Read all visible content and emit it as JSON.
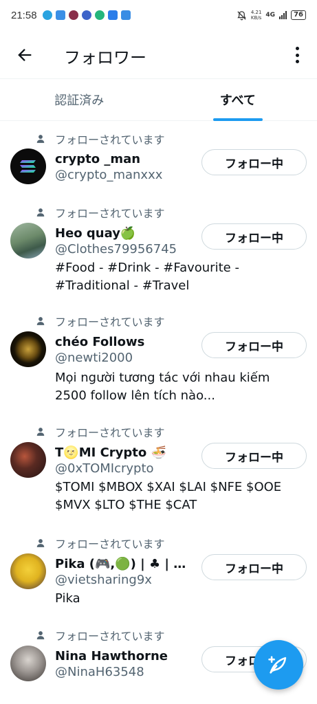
{
  "status_bar": {
    "time": "21:58",
    "network_speed_value": "4.21",
    "network_speed_unit": "KB/s",
    "network_type": "4G",
    "battery": "76"
  },
  "header": {
    "title": "フォロワー"
  },
  "tabs": [
    {
      "label": "認証済み",
      "active": false
    },
    {
      "label": "すべて",
      "active": true
    }
  ],
  "users": [
    {
      "context": "フォローされています",
      "name": "crypto _man",
      "handle": "@crypto_manxxx",
      "bio": "",
      "button": "フォロー中"
    },
    {
      "context": "フォローされています",
      "name": "Heo quay🍏",
      "handle": "@Clothes79956745",
      "bio": "#Food - #Drink - #Favourite - #Traditional - #Travel",
      "button": "フォロー中"
    },
    {
      "context": "フォローされています",
      "name": "chéo Follows",
      "handle": "@newti2000",
      "bio": "Mọi người tương tác với nhau kiếm 2500 follow lên tích nào...",
      "button": "フォロー中"
    },
    {
      "context": "フォローされています",
      "name": "T🌝MI Crypto 🍜",
      "handle": "@0xTOMIcrypto",
      "bio": "$TOMI $MBOX $XAI $LAI $NFE $OOE $MVX $LTO $THE $CAT",
      "button": "フォロー中"
    },
    {
      "context": "フォローされています",
      "name": "Pika (🎮,🟢) | ♣ | 🕹…",
      "handle": "@vietsharing9x",
      "bio": "Pika",
      "button": "フォロー中"
    },
    {
      "context": "フォローされています",
      "name": "Nina Hawthorne",
      "handle": "@NinaH63548",
      "bio": "",
      "button": "フォロー中"
    }
  ],
  "colors": {
    "accent": "#1d9bf0",
    "text_primary": "#0f1419",
    "text_secondary": "#536471",
    "border": "#cfd9de"
  },
  "icons": {
    "back": "arrow-left-icon",
    "more": "more-vertical-icon",
    "context": "person-icon",
    "fab": "compose-feather-icon"
  }
}
